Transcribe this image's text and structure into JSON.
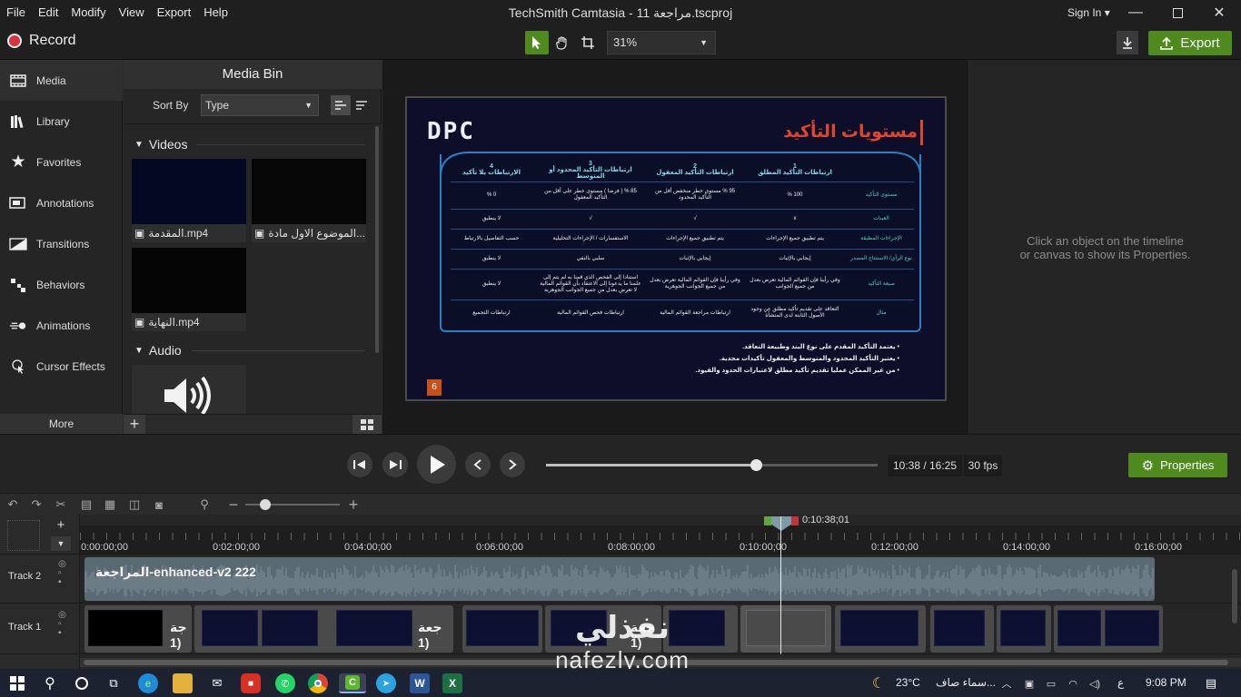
{
  "menubar": {
    "items": [
      "File",
      "Edit",
      "Modify",
      "View",
      "Export",
      "Help"
    ],
    "title": "TechSmith Camtasia - مراجعة 11.tscproj",
    "signin": "Sign In ▾"
  },
  "toolbar": {
    "record_label": "Record",
    "zoom_value": "31%",
    "export_label": "Export"
  },
  "sidebar": {
    "items": [
      {
        "label": "Media",
        "icon": "film-icon"
      },
      {
        "label": "Library",
        "icon": "library-icon"
      },
      {
        "label": "Favorites",
        "icon": "star-icon"
      },
      {
        "label": "Annotations",
        "icon": "annotation-icon"
      },
      {
        "label": "Transitions",
        "icon": "transition-icon"
      },
      {
        "label": "Behaviors",
        "icon": "behavior-icon"
      },
      {
        "label": "Animations",
        "icon": "animation-icon"
      },
      {
        "label": "Cursor Effects",
        "icon": "cursor-icon"
      }
    ],
    "more_label": "More"
  },
  "media_bin": {
    "title": "Media Bin",
    "sort_by_label": "Sort By",
    "sort_value": "Type",
    "videos_label": "Videos",
    "audio_label": "Audio",
    "videos": [
      {
        "name": "المقدمة.mp4"
      },
      {
        "name": "الموضوع الاول مادة..."
      },
      {
        "name": "النهاية.mp4"
      }
    ]
  },
  "properties_panel": {
    "hint_line1": "Click an object on the timeline",
    "hint_line2": "or canvas to show its Properties."
  },
  "slide": {
    "logo": "DPC",
    "heading": "مستويات التأكيد",
    "columns": [
      "",
      "1\nارتباطات التأكيد المطلق",
      "2\nارتباطات التأكيد المعقول",
      "3\nارتباطات  التأكيد المحدود أو المتوسط",
      "4\nالارتباطات بلا تأكيد"
    ],
    "rows": [
      [
        "مستوى التأكيد",
        "100  %",
        "95 % مستوى خطر منخفض أقل من التأكيد المحدود",
        "85 % ( فرضا ) مستوى خطر على أقل من التأكيد المعقول",
        "0  %"
      ],
      [
        "العينات",
        "x",
        "√",
        "√",
        "لا ينطبق"
      ],
      [
        "الإجراءات المطبقة",
        "يتم تطبيق جميع الإجراءات",
        "يتم تطبيق جميع الإجراءات",
        "الاستفسارات / الإجراءات التحليلية",
        "حسب التفاصيل بالارتباط"
      ],
      [
        "نوع الرأي/ الاستنتاج المصدر",
        "إيجابي بالإثبات",
        "إيجابي بالإثبات",
        "سلبي بالنفي",
        "لا ينطبق"
      ],
      [
        "صيغة التأكيد",
        "وفي رأينا فإن القوائم المالية تعرض بعدل من جميع الجوانب",
        "وفي رأينا فإن القوائم المالية تعرض بعدل من جميع الجوانب الجوهرية",
        "استنادا إلى الفحص الذي قمنا به لم يتم إلى علمنا ما يدعونا إلى الاعتقاد بأن القوائم المالية لا تعرض بعدل من جميع الجوانب الجوهرية",
        "لا ينطبق"
      ],
      [
        "مثال",
        "التعاقد على تقديم تأكيد مطلق عن وجود الأصول الثابتة لدى المنشأة",
        "ارتباطات مراجعة القوائم المالية",
        "ارتباطات فحص القوائم المالية",
        "ارتباطات التجميع"
      ]
    ],
    "bullets": [
      "يعتمد التأكيد المقدم على نوع البند وطبيعة التعاقد.",
      "يعتبر التأكيد المحدود والمتوسط والمعقول تأكيدات مجدية.",
      "من غير الممكن عمليا تقديم تأكيد مطلق لاعتبارات الحدود والقيود."
    ],
    "page_number": "6"
  },
  "playback": {
    "progress": 0.632,
    "time": "10:38 / 16:25",
    "fps": "30 fps",
    "properties_label": "Properties"
  },
  "timeline": {
    "playhead_time": "0:10:38;01",
    "ticks": [
      "0:00:00;00",
      "0:02:00;00",
      "0:04:00;00",
      "0:06:00;00",
      "0:08:00;00",
      "0:10:00;00",
      "0:12:00;00",
      "0:14:00;00",
      "0:16:00;00"
    ],
    "track2_label": "Track 2",
    "track1_label": "Track 1",
    "track2_clip": "المراجعة-enhanced-v2 222",
    "track1_clip_texts": [
      "جة (1",
      "جعة (1",
      "جعة (1"
    ]
  },
  "taskbar": {
    "temperature": "23°C",
    "weather": "سماء صاف...",
    "lang": "ع",
    "time": "9:08 PM"
  },
  "watermark": {
    "arabic": "نفذلي",
    "latin": "nafezly.com"
  },
  "colors": {
    "accent_green": "#4f8a1f",
    "record_red": "#e0303c",
    "slide_bg": "#0d0f2a",
    "slide_heading": "#e2452b",
    "teal": "#4fd1c5"
  }
}
